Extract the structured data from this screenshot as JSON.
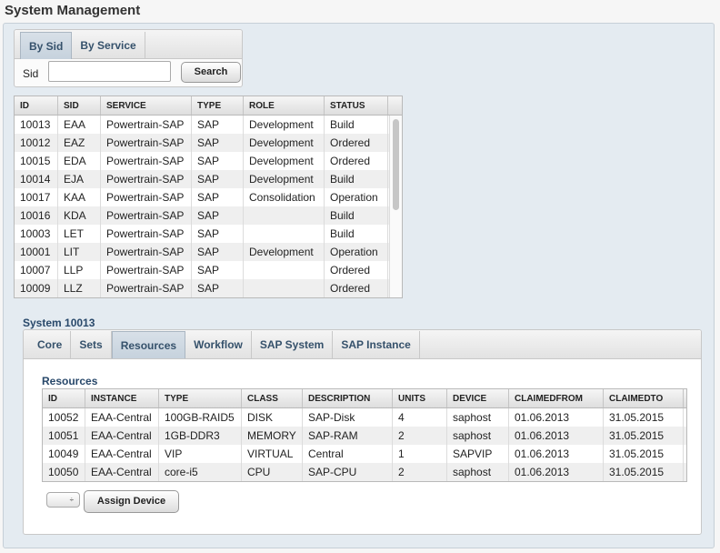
{
  "page_title": "System Management",
  "search": {
    "tabs": [
      "By Sid",
      "By Service"
    ],
    "active_tab": 0,
    "sid_label": "Sid",
    "sid_value": "",
    "search_button": "Search"
  },
  "systems": {
    "columns": [
      "ID",
      "SID",
      "SERVICE",
      "TYPE",
      "ROLE",
      "STATUS"
    ],
    "rows": [
      [
        "10013",
        "EAA",
        "Powertrain-SAP",
        "SAP",
        "Development",
        "Build"
      ],
      [
        "10012",
        "EAZ",
        "Powertrain-SAP",
        "SAP",
        "Development",
        "Ordered"
      ],
      [
        "10015",
        "EDA",
        "Powertrain-SAP",
        "SAP",
        "Development",
        "Ordered"
      ],
      [
        "10014",
        "EJA",
        "Powertrain-SAP",
        "SAP",
        "Development",
        "Build"
      ],
      [
        "10017",
        "KAA",
        "Powertrain-SAP",
        "SAP",
        "Consolidation",
        "Operation"
      ],
      [
        "10016",
        "KDA",
        "Powertrain-SAP",
        "SAP",
        "",
        "Build"
      ],
      [
        "10003",
        "LET",
        "Powertrain-SAP",
        "SAP",
        "",
        "Build"
      ],
      [
        "10001",
        "LIT",
        "Powertrain-SAP",
        "SAP",
        "Development",
        "Operation"
      ],
      [
        "10007",
        "LLP",
        "Powertrain-SAP",
        "SAP",
        "",
        "Ordered"
      ],
      [
        "10009",
        "LLZ",
        "Powertrain-SAP",
        "SAP",
        "",
        "Ordered"
      ]
    ]
  },
  "system_detail": {
    "title": "System 10013",
    "tabs": [
      "Core",
      "Sets",
      "Resources",
      "Workflow",
      "SAP System",
      "SAP Instance"
    ],
    "active_tab": 2,
    "resources_title": "Resources",
    "columns": [
      "ID",
      "INSTANCE",
      "TYPE",
      "CLASS",
      "DESCRIPTION",
      "UNITS",
      "DEVICE",
      "CLAIMEDFROM",
      "CLAIMEDTO"
    ],
    "rows": [
      [
        "10052",
        "EAA-Central",
        "100GB-RAID5",
        "DISK",
        "SAP-Disk",
        "4",
        "saphost",
        "01.06.2013",
        "31.05.2015"
      ],
      [
        "10051",
        "EAA-Central",
        "1GB-DDR3",
        "MEMORY",
        "SAP-RAM",
        "2",
        "saphost",
        "01.06.2013",
        "31.05.2015"
      ],
      [
        "10049",
        "EAA-Central",
        "VIP",
        "VIRTUAL",
        "Central",
        "1",
        "SAPVIP",
        "01.06.2013",
        "31.05.2015"
      ],
      [
        "10050",
        "EAA-Central",
        "core-i5",
        "CPU",
        "SAP-CPU",
        "2",
        "saphost",
        "01.06.2013",
        "31.05.2015"
      ]
    ],
    "select_arrow_glyph": "÷",
    "assign_button": "Assign Device"
  }
}
